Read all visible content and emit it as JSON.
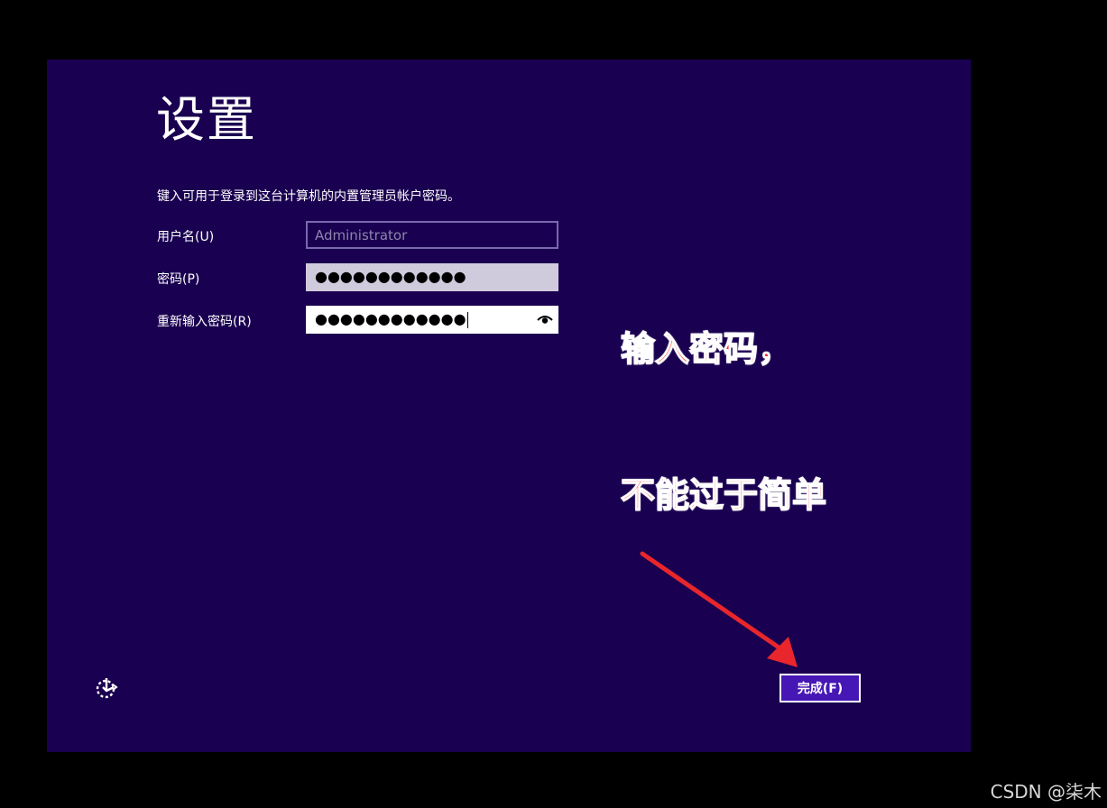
{
  "setup": {
    "title": "设置",
    "instruction": "键入可用于登录到这台计算机的内置管理员帐户密码。",
    "fields": {
      "username": {
        "label": "用户名(U)",
        "placeholder": "Administrator"
      },
      "password": {
        "label": "密码(P)",
        "masked_value": "●●●●●●●●●●●●"
      },
      "confirm": {
        "label": "重新输入密码(R)",
        "masked_value": "●●●●●●●●●●●●"
      }
    },
    "finish_button_label": "完成(F)"
  },
  "annotation": {
    "line1": "输入密码，",
    "line2": "不能过于简单"
  },
  "watermark": "CSDN @柒木",
  "icons": {
    "reveal_password": "eye-icon",
    "ease_of_access": "ease-of-access-icon",
    "annotation_arrow": "arrow-icon"
  },
  "colors": {
    "background": "#1a0050",
    "button": "#4617b4",
    "annotation": "#ff2a2a"
  }
}
